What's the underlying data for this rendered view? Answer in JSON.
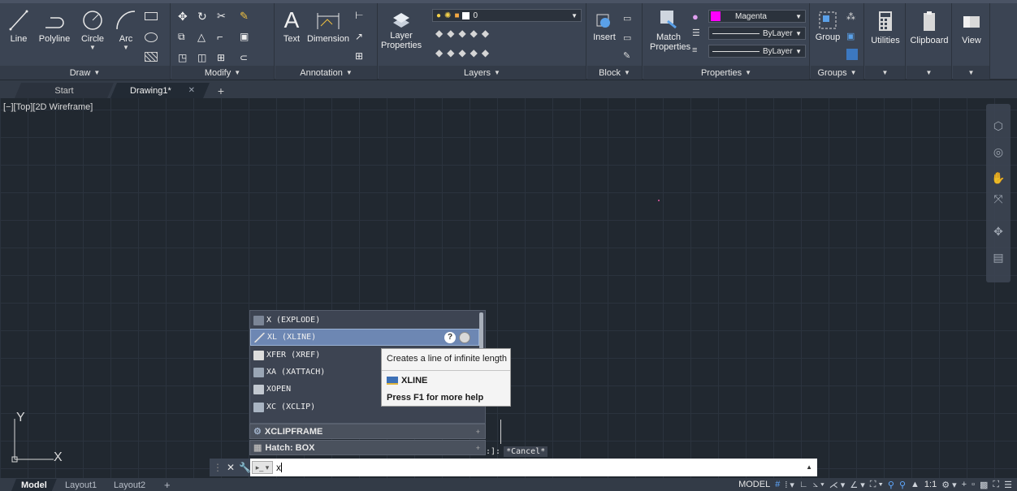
{
  "ribbon": {
    "draw": {
      "footer": "Draw",
      "tools": [
        "Line",
        "Polyline",
        "Circle",
        "Arc"
      ]
    },
    "modify": {
      "footer": "Modify"
    },
    "annotation": {
      "footer": "Annotation",
      "tools": [
        "Text",
        "Dimension"
      ]
    },
    "layers": {
      "footer": "Layers",
      "layer_properties": "Layer Properties",
      "current_layer": "0"
    },
    "block": {
      "footer": "Block",
      "insert": "Insert"
    },
    "properties": {
      "footer": "Properties",
      "match_properties": "Match Properties",
      "color": "Magenta",
      "linetype": "ByLayer",
      "lineweight": "ByLayer"
    },
    "groups": {
      "footer": "Groups",
      "group": "Group"
    },
    "utilities": "Utilities",
    "clipboard": "Clipboard",
    "view": "View"
  },
  "file_tabs": {
    "start": "Start",
    "drawing": "Drawing1*"
  },
  "viewport_label": "[−][Top][2D Wireframe]",
  "ucs": {
    "x": "X",
    "y": "Y"
  },
  "autocomplete": {
    "items": [
      {
        "label": "X (EXPLODE)"
      },
      {
        "label": "XL (XLINE)"
      },
      {
        "label": "XFER (XREF)"
      },
      {
        "label": "XA (XATTACH)"
      },
      {
        "label": "XOPEN"
      },
      {
        "label": "XC (XCLIP)"
      }
    ],
    "footer_items": [
      "XCLIPFRAME",
      "Hatch: BOX"
    ]
  },
  "tooltip": {
    "description": "Creates a line of infinite length",
    "command": "XLINE",
    "help": "Press F1 for more help"
  },
  "command_history": {
    "prefix": ":]:",
    "text": "*Cancel*"
  },
  "command_line": {
    "value": "x"
  },
  "layout_tabs": [
    "Model",
    "Layout1",
    "Layout2"
  ],
  "status": {
    "model": "MODEL",
    "scale": "1:1"
  },
  "colors": {
    "accent_selected": "#6d87b3",
    "magenta_swatch": "#ff00ff",
    "canvas": "#212830"
  }
}
